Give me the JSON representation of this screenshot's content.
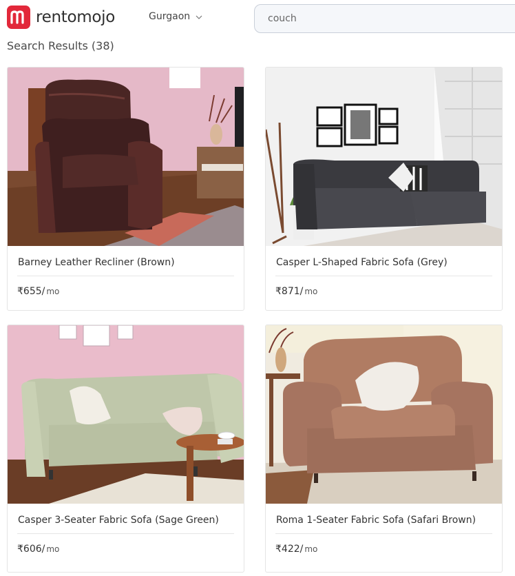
{
  "brand": {
    "name": "rentomojo",
    "logo_letter": "m"
  },
  "header": {
    "city": "Gurgaon"
  },
  "search": {
    "placeholder": "couch"
  },
  "results": {
    "title": "Search Results (38)"
  },
  "products": [
    {
      "name": "Barney Leather Recliner (Brown)",
      "price": "₹655/",
      "unit": "mo"
    },
    {
      "name": "Casper L-Shaped Fabric Sofa (Grey)",
      "price": "₹871/",
      "unit": "mo"
    },
    {
      "name": "Casper 3-Seater Fabric Sofa (Sage Green)",
      "price": "₹606/",
      "unit": "mo"
    },
    {
      "name": "Roma 1-Seater Fabric Sofa (Safari Brown)",
      "price": "₹422/",
      "unit": "mo"
    }
  ],
  "colors": {
    "brand_red": "#e2283a",
    "text": "#333333",
    "search_bg": "#f5f7fa"
  },
  "icons": {
    "city_dropdown": "chevron-down-icon"
  }
}
